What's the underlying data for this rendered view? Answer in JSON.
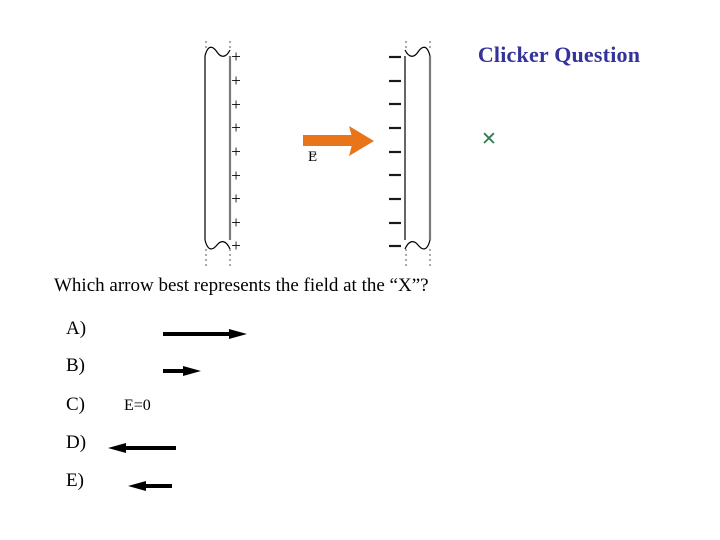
{
  "slide": {
    "title": "Clicker Question",
    "title_color": "#33339A",
    "background": "#FFFFFF"
  },
  "figure": {
    "description": "Parallel plate capacitor with positively charged left plate and negatively charged right plate",
    "left_plate": {
      "name": "positive-plate",
      "charge_symbol": "+",
      "charge_count": 9,
      "outline_color": "#000000",
      "face_color": "#808080"
    },
    "right_plate": {
      "name": "negative-plate",
      "charge_symbol": "−",
      "charge_count": 9,
      "outline_color": "#000000",
      "face_color": "#808080"
    },
    "field_arrow": {
      "name": "field-arrow",
      "color": "#E8751A",
      "direction": "right",
      "label": "E",
      "label_accent": "→"
    },
    "test_point": {
      "name": "x-marker",
      "symbol": "✕",
      "color": "#2E7D4F"
    }
  },
  "question": {
    "text": "Which arrow best represents the field at the “X”?"
  },
  "options": [
    {
      "label": "A)",
      "answer_type": "arrow",
      "direction": "right",
      "length": "long",
      "text": ""
    },
    {
      "label": "B)",
      "answer_type": "arrow",
      "direction": "right",
      "length": "short",
      "text": ""
    },
    {
      "label": "C)",
      "answer_type": "text",
      "direction": "none",
      "length": "none",
      "text": "E=0"
    },
    {
      "label": "D)",
      "answer_type": "arrow",
      "direction": "left",
      "length": "long",
      "text": ""
    },
    {
      "label": "E)",
      "answer_type": "arrow",
      "direction": "left",
      "length": "short",
      "text": ""
    }
  ]
}
